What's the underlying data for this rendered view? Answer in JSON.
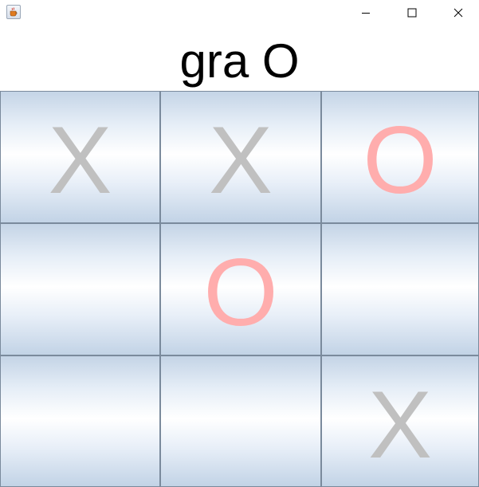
{
  "window": {
    "icon": "java-cup-icon"
  },
  "header": {
    "title": "gra O"
  },
  "board": {
    "cells": [
      {
        "mark": "X",
        "kind": "x"
      },
      {
        "mark": "X",
        "kind": "x"
      },
      {
        "mark": "O",
        "kind": "o"
      },
      {
        "mark": "",
        "kind": "empty"
      },
      {
        "mark": "O",
        "kind": "o"
      },
      {
        "mark": "",
        "kind": "empty"
      },
      {
        "mark": "",
        "kind": "empty"
      },
      {
        "mark": "",
        "kind": "empty"
      },
      {
        "mark": "X",
        "kind": "x"
      }
    ]
  },
  "colors": {
    "x_mark": "#c0c0c0",
    "o_mark": "#ffadad",
    "cell_border": "#7a8a9c"
  }
}
